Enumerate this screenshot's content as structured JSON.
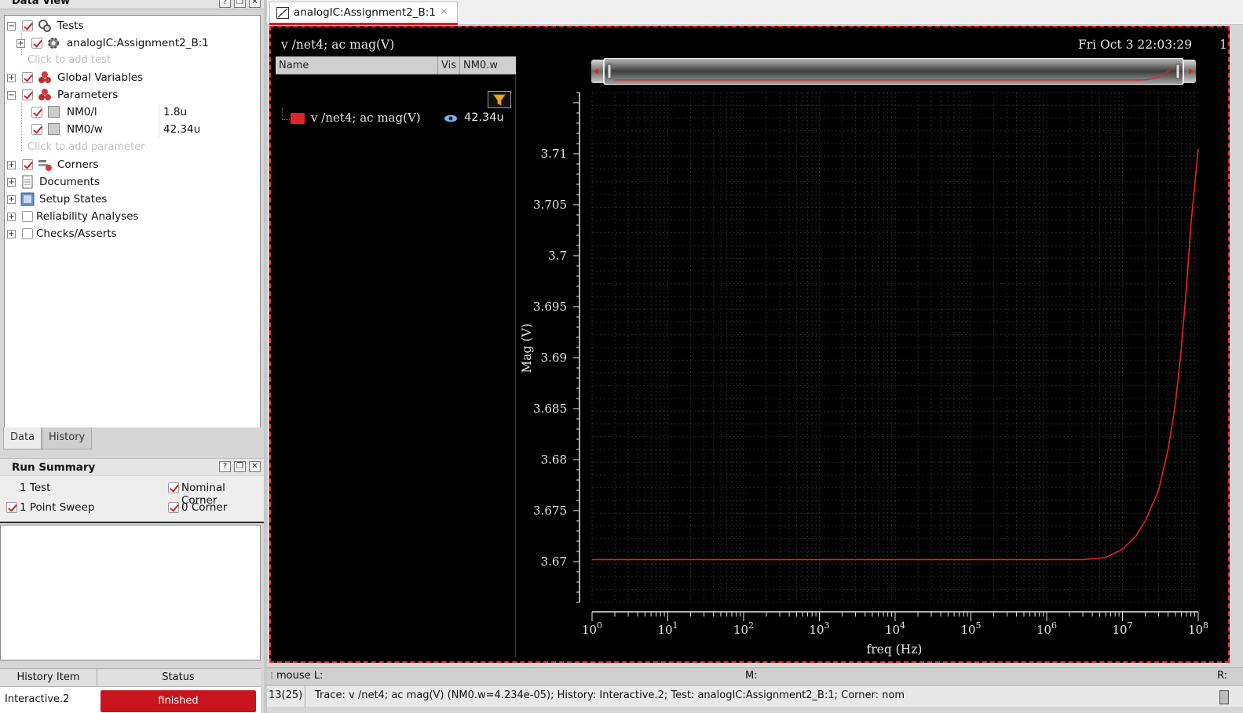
{
  "data_view": {
    "title": "Data View",
    "tree": {
      "tests": "Tests",
      "test_item": "analogIC:Assignment2_B:1",
      "add_test": "Click to add test",
      "global_variables": "Global Variables",
      "parameters": "Parameters",
      "params": [
        {
          "name": "NM0/l",
          "value": "1.8u"
        },
        {
          "name": "NM0/w",
          "value": "42.34u"
        }
      ],
      "add_parameter": "Click to add parameter",
      "corners": "Corners",
      "documents": "Documents",
      "setup_states": "Setup States",
      "reliability": "Reliability Analyses",
      "checks": "Checks/Asserts"
    },
    "tabs": [
      "Data",
      "History"
    ]
  },
  "run_summary": {
    "title": "Run Summary",
    "tests": "1 Test",
    "sweep": "1 Point Sweep",
    "nominal": "Nominal Corner",
    "corner": "0 Corner"
  },
  "history": {
    "col_item": "History Item",
    "col_status": "Status",
    "item": "Interactive.2",
    "status": "finished"
  },
  "plot_tab": {
    "label": "analogIC:Assignment2_B:1"
  },
  "plot": {
    "title": "v /net4; ac mag(V)",
    "timestamp": "Fri Oct 3 22:03:29",
    "edge_label": "1",
    "legend": {
      "headers": [
        "Name",
        "Vis",
        "NM0.w"
      ],
      "trace_name": "v /net4; ac mag(V)",
      "trace_value": "42.34u"
    },
    "colors": {
      "trace": "#e3232a",
      "background": "#000000",
      "grid": "#2a2a2a"
    }
  },
  "chart_data": {
    "type": "line",
    "title": "v /net4; ac mag(V)",
    "xlabel": "freq (Hz)",
    "ylabel": "Mag (V)",
    "x_scale": "log",
    "xlim": [
      1,
      100000000
    ],
    "ylim": [
      3.666,
      3.716
    ],
    "x_ticks": [
      "10^0",
      "10^1",
      "10^2",
      "10^3",
      "10^4",
      "10^5",
      "10^6",
      "10^7",
      "10^8"
    ],
    "y_ticks": [
      3.67,
      3.675,
      3.68,
      3.685,
      3.69,
      3.695,
      3.7,
      3.705,
      3.71
    ],
    "y_tick_labels": [
      "3.67",
      "3.675",
      "3.68",
      "3.685",
      "3.69",
      "3.695",
      "3.7",
      "3.705",
      "3.71"
    ],
    "grid": true,
    "series": [
      {
        "name": "v /net4; ac mag(V)",
        "color": "#e3232a",
        "x": [
          1,
          100000,
          1000000,
          3000000,
          6000000,
          10000000,
          15000000,
          20000000,
          30000000,
          40000000,
          50000000,
          60000000,
          70000000,
          80000000,
          90000000,
          100000000
        ],
        "y": [
          3.6702,
          3.6702,
          3.6702,
          3.6702,
          3.6704,
          3.6712,
          3.6725,
          3.674,
          3.677,
          3.681,
          3.6855,
          3.691,
          3.697,
          3.703,
          3.707,
          3.7105
        ]
      }
    ]
  },
  "status": {
    "mouse_l": "mouse L:",
    "m": "M:",
    "r": "R:",
    "count": "13(25)",
    "trace_info": "Trace: v /net4; ac mag(V) (NM0.w=4.234e-05); History: Interactive.2; Test: analogIC:Assignment2_B:1; Corner: nom"
  }
}
